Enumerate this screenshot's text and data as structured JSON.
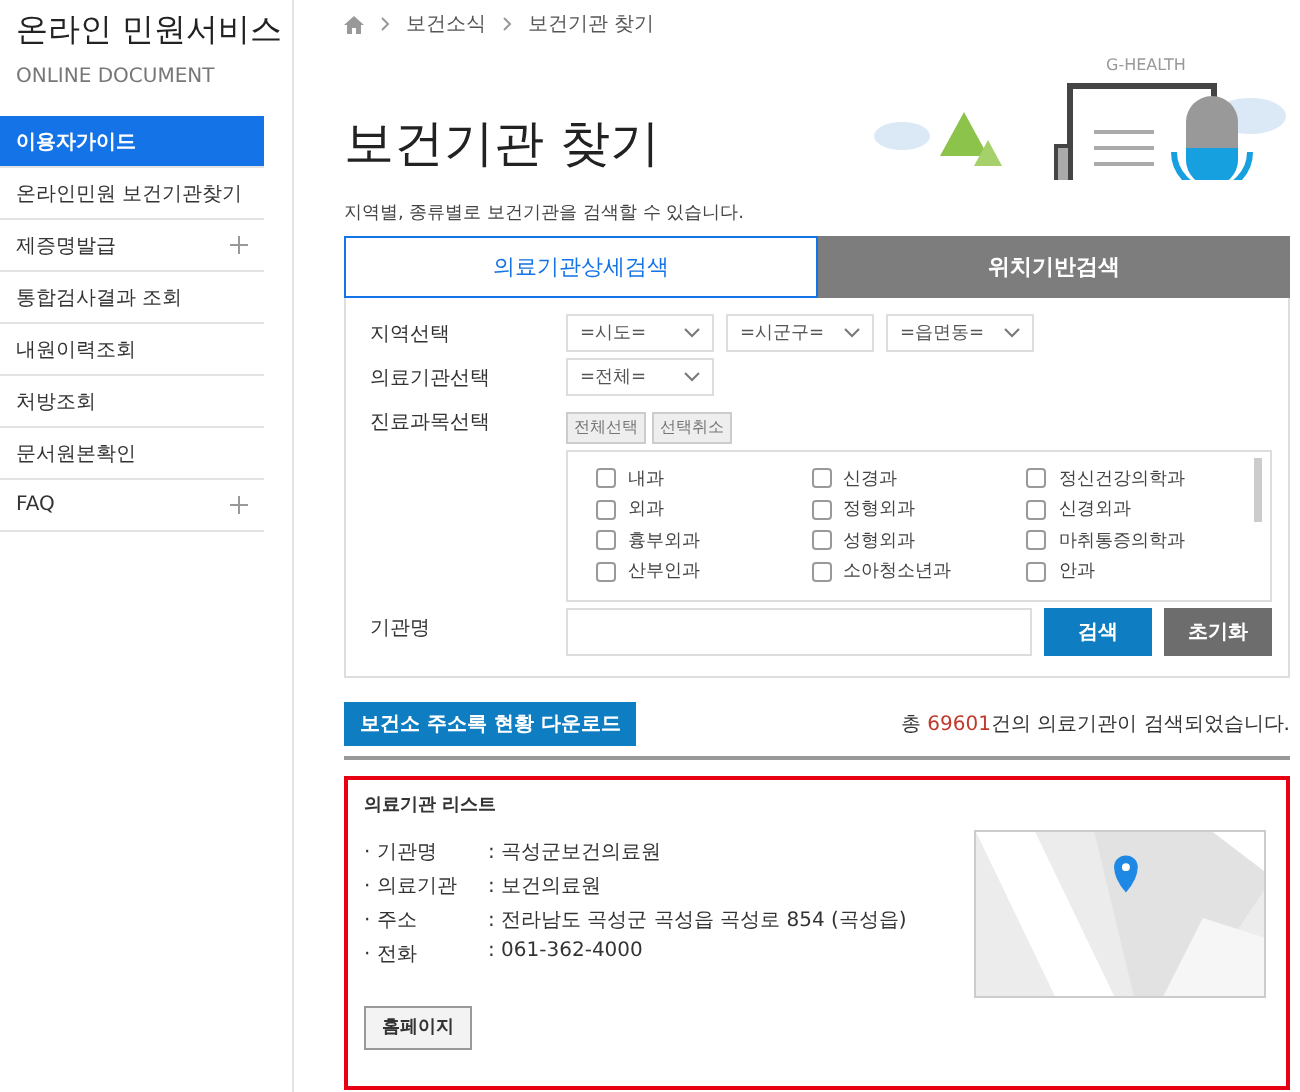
{
  "sidebar": {
    "title": "온라인 민원서비스",
    "subtitle": "ONLINE DOCUMENT",
    "items": [
      {
        "label": "이용자가이드",
        "selected": true,
        "expandable": false
      },
      {
        "label": "온라인민원 보건기관찾기",
        "selected": false,
        "expandable": false
      },
      {
        "label": "제증명발급",
        "selected": false,
        "expandable": true
      },
      {
        "label": "통합검사결과 조회",
        "selected": false,
        "expandable": false
      },
      {
        "label": "내원이력조회",
        "selected": false,
        "expandable": false
      },
      {
        "label": "처방조회",
        "selected": false,
        "expandable": false
      },
      {
        "label": "문서원본확인",
        "selected": false,
        "expandable": false
      },
      {
        "label": "FAQ",
        "selected": false,
        "expandable": true
      }
    ]
  },
  "breadcrumb": [
    "보건소식",
    "보건기관 찾기"
  ],
  "page_title": "보건기관 찾기",
  "banner_text": "G-HEALTH",
  "description": "지역별, 종류별로 보건기관을 검색할 수 있습니다.",
  "tabs": [
    {
      "label": "의료기관상세검색",
      "selected": true
    },
    {
      "label": "위치기반검색",
      "selected": false
    }
  ],
  "form": {
    "region_label": "지역선택",
    "region_selects": [
      "=시도=",
      "=시군구=",
      "=읍면동="
    ],
    "type_label": "의료기관선택",
    "type_select": "=전체=",
    "dept_label": "진료과목선택",
    "dept_buttons": [
      "전체선택",
      "선택취소"
    ],
    "departments": [
      {
        "label": "내과",
        "checked": false
      },
      {
        "label": "신경과",
        "checked": false
      },
      {
        "label": "정신건강의학과",
        "checked": false
      },
      {
        "label": "외과",
        "checked": false
      },
      {
        "label": "정형외과",
        "checked": false
      },
      {
        "label": "신경외과",
        "checked": false
      },
      {
        "label": "흉부외과",
        "checked": false
      },
      {
        "label": "성형외과",
        "checked": false
      },
      {
        "label": "마취통증의학과",
        "checked": false
      },
      {
        "label": "산부인과",
        "checked": false
      },
      {
        "label": "소아청소년과",
        "checked": false
      },
      {
        "label": "안과",
        "checked": false
      }
    ],
    "name_label": "기관명",
    "search_button": "검색",
    "reset_button": "초기화"
  },
  "download_button": "보건소 주소록 현황 다운로드",
  "result": {
    "prefix": "총 ",
    "count": "69601",
    "suffix": "건의 의료기관이 검색되었습니다."
  },
  "list": {
    "title": "의료기관 리스트",
    "fields": [
      {
        "label": "· 기관명",
        "value": ": 곡성군보건의료원"
      },
      {
        "label": "· 의료기관",
        "value": ": 보건의료원"
      },
      {
        "label": "· 주소",
        "value": ": 전라남도 곡성군 곡성읍 곡성로 854 (곡성읍)"
      },
      {
        "label": "· 전화",
        "value": ": 061-362-4000"
      }
    ],
    "homepage_button": "홈페이지"
  }
}
